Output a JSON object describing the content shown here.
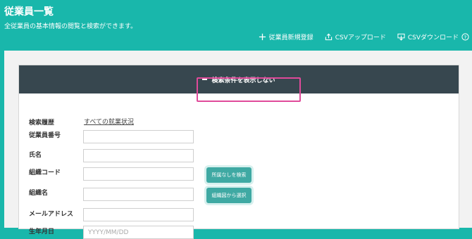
{
  "header": {
    "title": "従業員一覧",
    "subtitle": "全従業員の基本情報の閲覧と検索ができます。",
    "actions": [
      {
        "label": "従業員新規登録",
        "icon": "plus-icon"
      },
      {
        "label": "CSVアップロード",
        "icon": "upload-icon"
      },
      {
        "label": "CSVダウンロード",
        "icon": "download-icon"
      }
    ],
    "help_icon": "help-icon"
  },
  "search_panel": {
    "toggle_label": "検索条件を表示しない",
    "history": {
      "label": "検索履歴",
      "link": "すべての就業状況"
    },
    "fields": [
      {
        "label": "従業員番号",
        "value": "",
        "placeholder": ""
      },
      {
        "label": "氏名",
        "value": "",
        "placeholder": ""
      },
      {
        "label": "組織コード",
        "value": "",
        "placeholder": ""
      },
      {
        "label": "組織名",
        "value": "",
        "placeholder": ""
      },
      {
        "label": "メールアドレス",
        "value": "",
        "placeholder": ""
      },
      {
        "label": "生年月日",
        "value": "",
        "placeholder": "YYYY/MM/DD"
      }
    ],
    "buttons": {
      "search_unassigned": "所属なしを検索",
      "select_from_org_chart": "組織図から選択"
    }
  },
  "colors": {
    "header_bg": "#19b7ab",
    "bar_bg": "#37474f",
    "button_bg": "#3fa9a3",
    "highlight": "#e04a9a"
  }
}
